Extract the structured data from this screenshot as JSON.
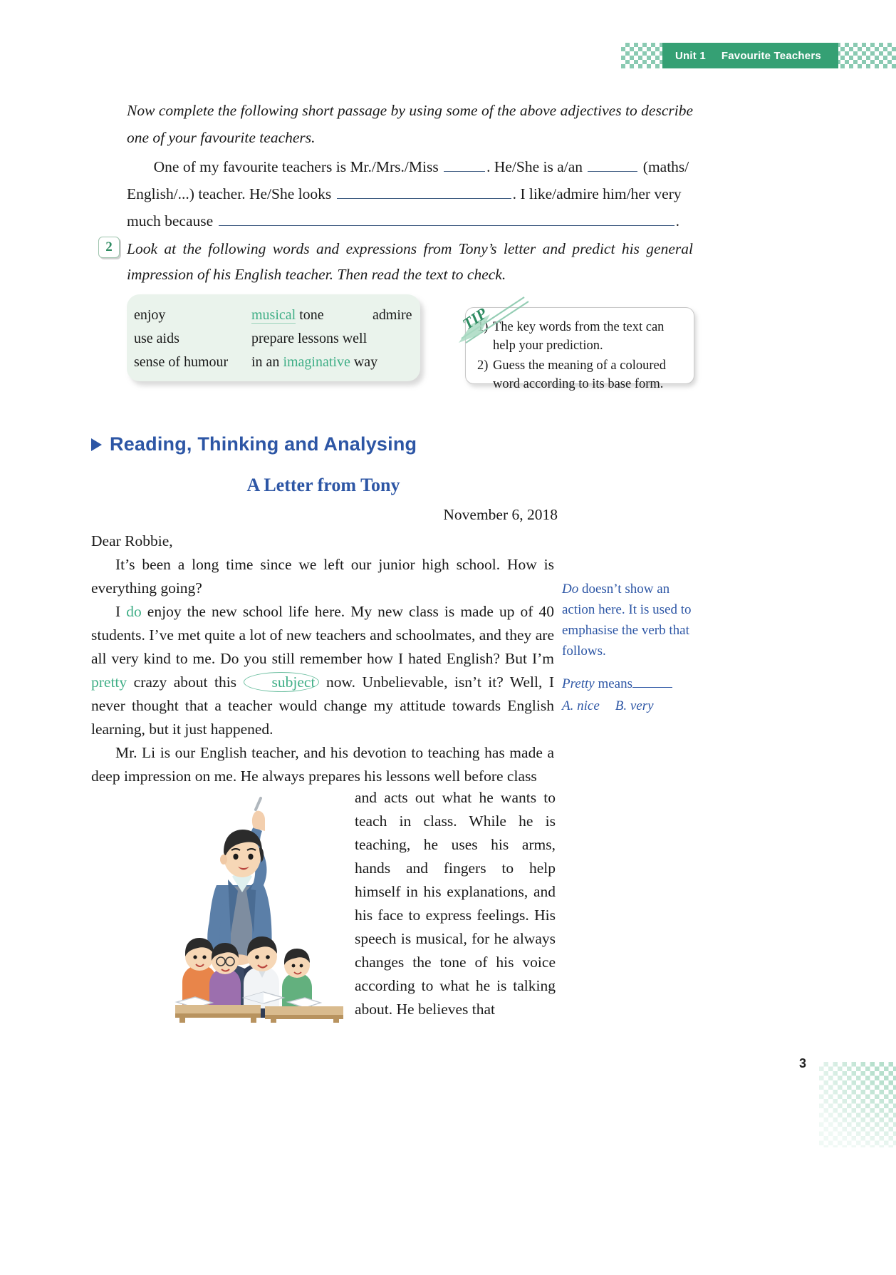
{
  "header": {
    "unit_number": "Unit 1",
    "unit_title": "Favourite Teachers",
    "accent_color": "#35a074"
  },
  "intro": {
    "instruction": "Now complete the following short passage by using some of the above adjectives to describe one of your favourite teachers."
  },
  "passage": {
    "line1_a": "One of my favourite teachers is Mr./Mrs./Miss",
    "line1_b": ". He/She is a/an",
    "line1_c": "(maths/",
    "line2_a": "English/...)  teacher. He/She looks",
    "line2_b": ". I like/admire him/her very",
    "line3_a": "much because",
    "line3_b": "."
  },
  "exercise2": {
    "number": "2",
    "instruction": "Look at the following words and expressions from Tony’s letter and predict his general impression of his English teacher. Then read the text to check."
  },
  "word_box": {
    "cells": [
      {
        "text": "enjoy",
        "highlight": false
      },
      {
        "text": "musical",
        "highlight": true,
        "suffix": " tone"
      },
      {
        "text": "admire",
        "highlight": false
      },
      {
        "text": "use aids",
        "highlight": false
      },
      {
        "text": "prepare lessons well",
        "highlight": false
      },
      {
        "text": "",
        "highlight": false
      },
      {
        "text": "sense of humour",
        "highlight": false
      },
      {
        "text": "in an ",
        "highlight": false,
        "green_word": "imaginative",
        "tail": " way"
      },
      {
        "text": "",
        "highlight": false
      }
    ],
    "background_color": "#eaf3ec",
    "highlight_color": "#3fae86"
  },
  "tip_box": {
    "label": "TIP",
    "items": [
      {
        "num": "1)",
        "text": "The key words from the text can help your prediction."
      },
      {
        "num": "2)",
        "text": "Guess the meaning of a coloured word according to its base form."
      }
    ]
  },
  "reading_section": {
    "heading": "Reading, Thinking and Analysing",
    "heading_color": "#2d56a5",
    "letter_title": "A Letter from Tony",
    "letter_date": "November 6, 2018"
  },
  "letter": {
    "salutation": "Dear Robbie,",
    "para1": "It’s been a long time since we left our junior high school. How is everything going?",
    "para2_part1": "I ",
    "para2_do": "do",
    "para2_part2": " enjoy the new school life here. My new class is made up of 40 students. I’ve met quite a lot of new teachers and schoolmates, and they are all very kind to me. Do you still remember how I hated English? But I’m ",
    "para2_pretty": "pretty",
    "para2_part3": " crazy about this ",
    "para2_subject": "subject",
    "para2_part4": " now. Unbelievable, isn’t it? Well, I never thought that a teacher would change my attitude towards English learning, but it just happened.",
    "para3": "Mr. Li is our English teacher, and his devotion to teaching has made a deep impression on me. He always prepares his lessons well before class",
    "para3_wrap": "and acts out what he wants to teach in class. While he is teaching, he uses his arms, hands and fingers to help himself in his explanations, and his face to express feelings. His speech is musical, for he always changes the tone of his voice according to what he is talking about. He believes that"
  },
  "annotations": {
    "do_note": "Do doesn’t show an action here. It is used to emphasise the verb that follows.",
    "do_note_italic": "Do",
    "do_note_rest": " doesn’t show an action here. It is used to emphasise the verb that follows.",
    "pretty_italic": "Pretty",
    "pretty_rest": " means",
    "option_a": "A. nice",
    "option_b": "B. very"
  },
  "footer": {
    "page_number": "3"
  }
}
